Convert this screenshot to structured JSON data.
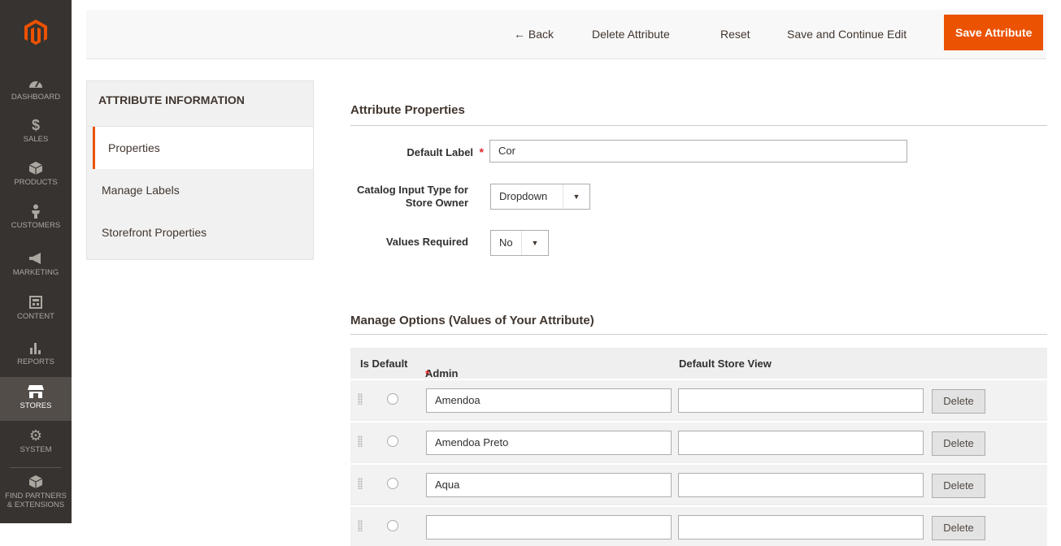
{
  "menu": {
    "items": [
      {
        "label": "DASHBOARD",
        "icon": "dashboard-gauge-icon"
      },
      {
        "label": "SALES",
        "icon": "dollar-icon"
      },
      {
        "label": "PRODUCTS",
        "icon": "cube-icon"
      },
      {
        "label": "CUSTOMERS",
        "icon": "person-icon"
      },
      {
        "label": "MARKETING",
        "icon": "megaphone-icon"
      },
      {
        "label": "CONTENT",
        "icon": "layout-icon"
      },
      {
        "label": "REPORTS",
        "icon": "bar-chart-icon"
      },
      {
        "label": "STORES",
        "icon": "storefront-icon"
      },
      {
        "label": "SYSTEM",
        "icon": "gear-icon"
      },
      {
        "label": "FIND PARTNERS & EXTENSIONS",
        "icon": "box-icon"
      }
    ]
  },
  "actions": {
    "back": "← Back",
    "delete": "Delete Attribute",
    "reset": "Reset",
    "save_continue": "Save and Continue Edit",
    "save": "Save Attribute"
  },
  "tabs": {
    "title": "ATTRIBUTE INFORMATION",
    "items": [
      "Properties",
      "Manage Labels",
      "Storefront Properties"
    ]
  },
  "properties": {
    "title": "Attribute Properties",
    "default_label": {
      "label": "Default Label",
      "value": "Cor"
    },
    "input_type": {
      "label": "Catalog Input Type for Store Owner",
      "value": "Dropdown"
    },
    "values_required": {
      "label": "Values Required",
      "value": "No"
    }
  },
  "options": {
    "title": "Manage Options (Values of Your Attribute)",
    "headers": {
      "is_default": "Is Default",
      "admin": "Admin",
      "store_view": "Default Store View"
    },
    "delete_label": "Delete",
    "rows": [
      {
        "admin": "Amendoa",
        "store_view": ""
      },
      {
        "admin": "Amendoa Preto",
        "store_view": ""
      },
      {
        "admin": "Aqua",
        "store_view": ""
      },
      {
        "admin": "",
        "store_view": ""
      }
    ]
  },
  "colors": {
    "accent": "#eb5202",
    "menu_bg": "#373330",
    "required": "#e22626"
  }
}
